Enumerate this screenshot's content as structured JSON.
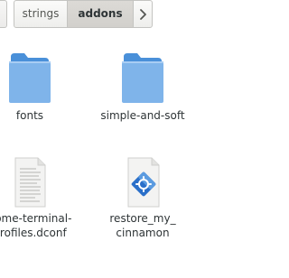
{
  "pathbar": {
    "crumbs": [
      {
        "label": "strings",
        "active": false
      },
      {
        "label": "addons",
        "active": true
      }
    ],
    "next_icon": "chevron-right-icon"
  },
  "files": [
    {
      "name": "fonts",
      "type": "folder",
      "icon": "folder-icon"
    },
    {
      "name": "simple-and-soft",
      "type": "folder",
      "icon": "folder-icon"
    },
    {
      "name_lines": [
        "nome-terminal-",
        "profiles.dconf"
      ],
      "type": "text-file",
      "icon": "text-file-icon"
    },
    {
      "name_lines": [
        "restore_my_",
        "cinnamon"
      ],
      "type": "executable",
      "icon": "executable-script-icon"
    }
  ],
  "colors": {
    "folder_back": "#4a90d9",
    "folder_front": "#7fb4ea",
    "exec_blue": "#2a6fc9",
    "selected_crumb": "#d6d4d0"
  }
}
